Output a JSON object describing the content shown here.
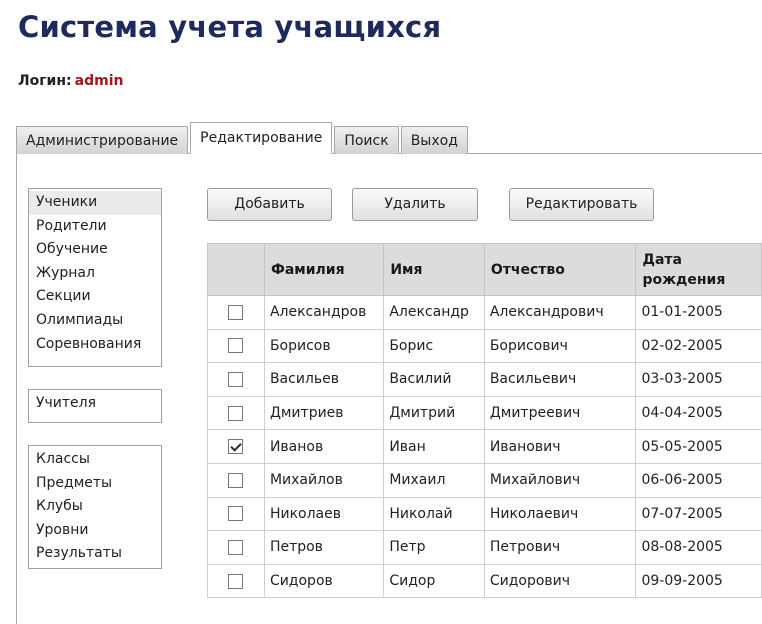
{
  "app": {
    "title": "Система учета учащихся"
  },
  "login": {
    "label": "Логин:",
    "value": "admin"
  },
  "tabs": [
    {
      "label": "Администрирование",
      "active": false
    },
    {
      "label": "Редактирование",
      "active": true
    },
    {
      "label": "Поиск",
      "active": false
    },
    {
      "label": "Выход",
      "active": false
    }
  ],
  "nav": {
    "group1": [
      "Ученики",
      "Родители",
      "Обучение",
      "Журнал",
      "Секции",
      "Олимпиады",
      "Соревнования"
    ],
    "group1_selected": "Ученики",
    "group2": [
      "Учителя"
    ],
    "group3": [
      "Классы",
      "Предметы",
      "Клубы",
      "Уровни",
      "Результаты"
    ]
  },
  "actions": {
    "add": "Добавить",
    "delete": "Удалить",
    "edit": "Редактировать"
  },
  "table": {
    "columns": [
      "",
      "Фамилия",
      "Имя",
      "Отчество",
      "Дата рождения"
    ],
    "rows": [
      {
        "checked": false,
        "last": "Александров",
        "first": "Александр",
        "middle": "Александрович",
        "dob": "01-01-2005"
      },
      {
        "checked": false,
        "last": "Борисов",
        "first": "Борис",
        "middle": "Борисович",
        "dob": "02-02-2005"
      },
      {
        "checked": false,
        "last": "Васильев",
        "first": "Василий",
        "middle": "Васильевич",
        "dob": "03-03-2005"
      },
      {
        "checked": false,
        "last": "Дмитриев",
        "first": "Дмитрий",
        "middle": "Дмитреевич",
        "dob": "04-04-2005"
      },
      {
        "checked": true,
        "last": "Иванов",
        "first": "Иван",
        "middle": "Иванович",
        "dob": "05-05-2005"
      },
      {
        "checked": false,
        "last": "Михайлов",
        "first": "Михаил",
        "middle": "Михайлович",
        "dob": "06-06-2005"
      },
      {
        "checked": false,
        "last": "Николаев",
        "first": "Николай",
        "middle": "Николаевич",
        "dob": "07-07-2005"
      },
      {
        "checked": false,
        "last": "Петров",
        "first": "Петр",
        "middle": "Петрович",
        "dob": "08-08-2005"
      },
      {
        "checked": false,
        "last": "Сидоров",
        "first": "Сидор",
        "middle": "Сидорович",
        "dob": "09-09-2005"
      }
    ]
  }
}
